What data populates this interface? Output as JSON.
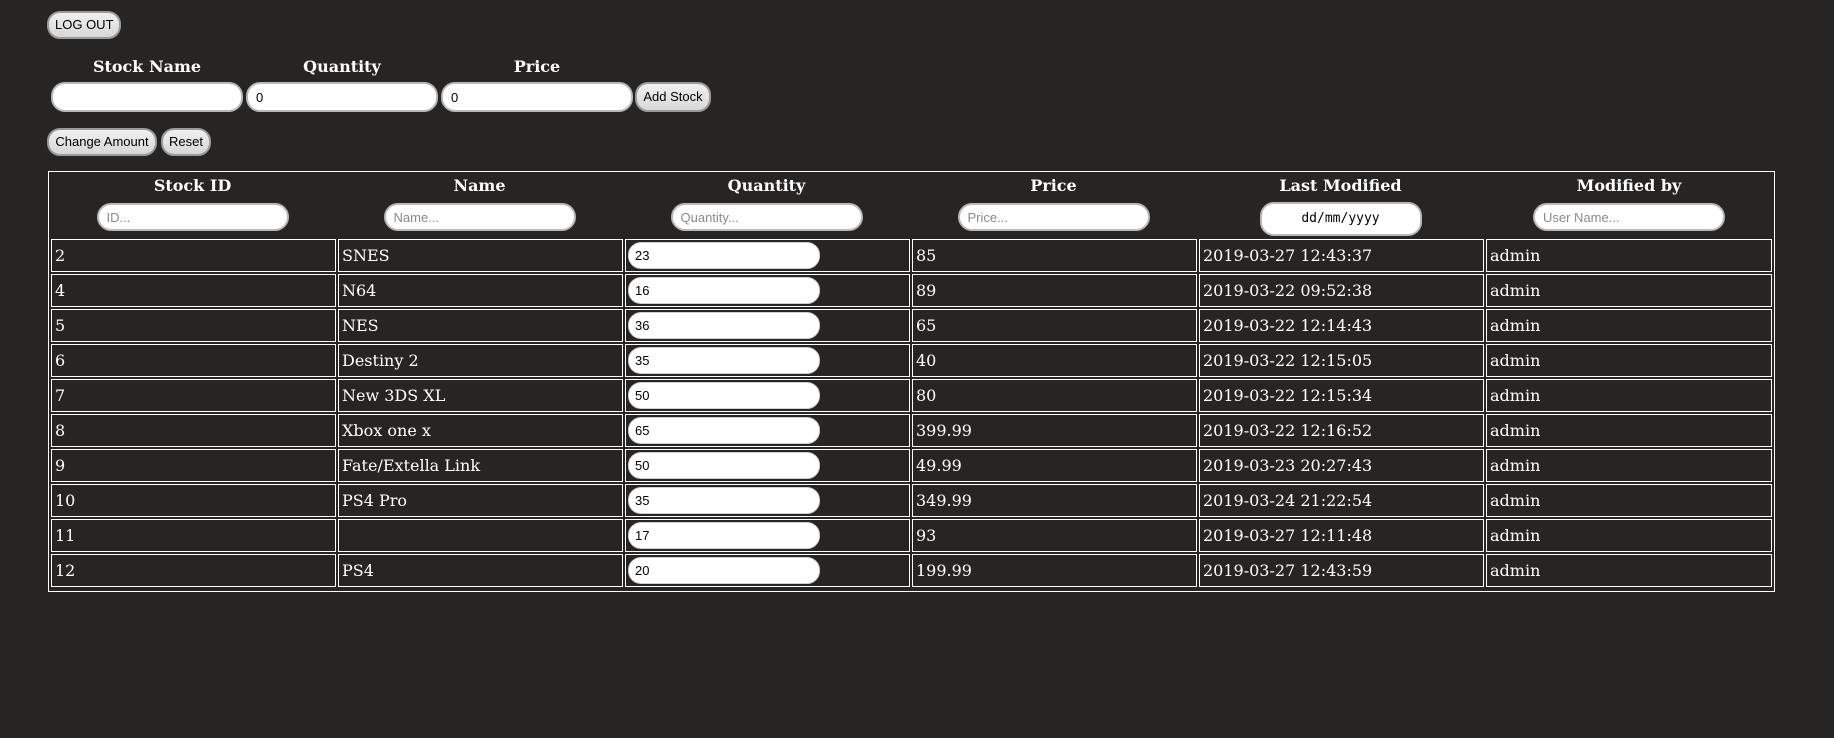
{
  "header": {
    "logout_label": "LOG OUT"
  },
  "add_form": {
    "stock_name_label": "Stock Name",
    "quantity_label": "Quantity",
    "price_label": "Price",
    "stock_name_value": "",
    "quantity_value": "0",
    "price_value": "0",
    "add_stock_label": "Add Stock"
  },
  "actions": {
    "change_amount_label": "Change Amount",
    "reset_label": "Reset"
  },
  "table": {
    "columns": [
      {
        "title": "Stock ID",
        "placeholder": "ID..."
      },
      {
        "title": "Name",
        "placeholder": "Name..."
      },
      {
        "title": "Quantity",
        "placeholder": "Quantity..."
      },
      {
        "title": "Price",
        "placeholder": "Price..."
      },
      {
        "title": "Last Modified",
        "placeholder": "dd/mm/yyyy"
      },
      {
        "title": "Modified by",
        "placeholder": "User Name..."
      }
    ],
    "rows": [
      {
        "id": "2",
        "name": "SNES",
        "quantity": "23",
        "price": "85",
        "modified": "2019-03-27 12:43:37",
        "user": "admin"
      },
      {
        "id": "4",
        "name": "N64",
        "quantity": "16",
        "price": "89",
        "modified": "2019-03-22 09:52:38",
        "user": "admin"
      },
      {
        "id": "5",
        "name": "NES",
        "quantity": "36",
        "price": "65",
        "modified": "2019-03-22 12:14:43",
        "user": "admin"
      },
      {
        "id": "6",
        "name": "Destiny 2",
        "quantity": "35",
        "price": "40",
        "modified": "2019-03-22 12:15:05",
        "user": "admin"
      },
      {
        "id": "7",
        "name": "New 3DS XL",
        "quantity": "50",
        "price": "80",
        "modified": "2019-03-22 12:15:34",
        "user": "admin"
      },
      {
        "id": "8",
        "name": "Xbox one x",
        "quantity": "65",
        "price": "399.99",
        "modified": "2019-03-22 12:16:52",
        "user": "admin"
      },
      {
        "id": "9",
        "name": "Fate/Extella Link",
        "quantity": "50",
        "price": "49.99",
        "modified": "2019-03-23 20:27:43",
        "user": "admin"
      },
      {
        "id": "10",
        "name": "PS4 Pro",
        "quantity": "35",
        "price": "349.99",
        "modified": "2019-03-24 21:22:54",
        "user": "admin"
      },
      {
        "id": "11",
        "name": "",
        "quantity": "17",
        "price": "93",
        "modified": "2019-03-27 12:11:48",
        "user": "admin"
      },
      {
        "id": "12",
        "name": "PS4",
        "quantity": "20",
        "price": "199.99",
        "modified": "2019-03-27 12:43:59",
        "user": "admin"
      }
    ]
  }
}
